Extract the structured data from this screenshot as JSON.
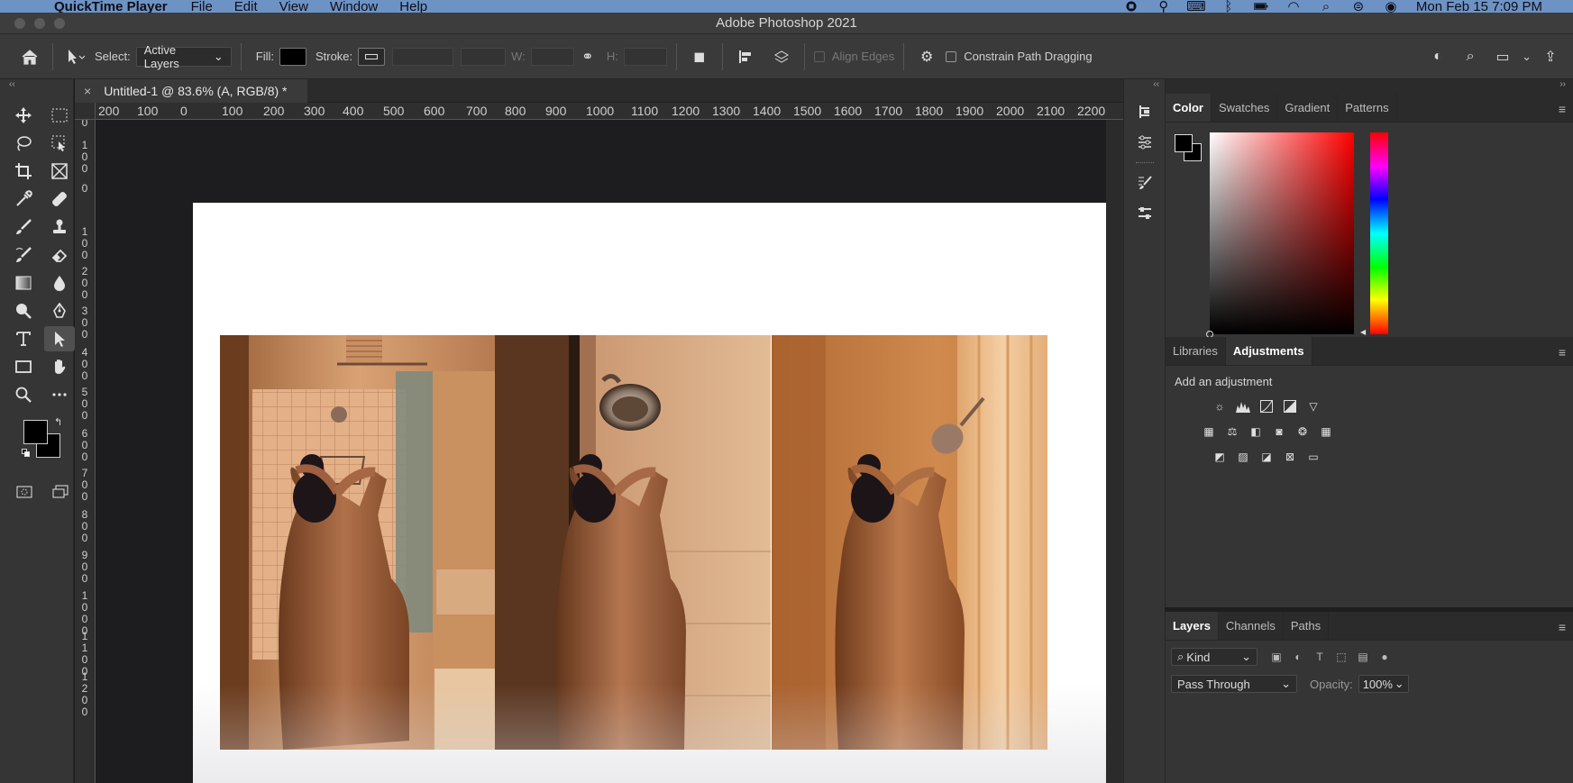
{
  "menubar": {
    "app": "QuickTime Player",
    "items": [
      "File",
      "Edit",
      "View",
      "Window",
      "Help"
    ],
    "clock": "Mon Feb 15  7:09 PM",
    "status_icons": [
      "record-icon",
      "accessibility-icon",
      "keyboard-icon",
      "bluetooth-icon",
      "battery-icon",
      "wifi-icon",
      "spotlight-icon",
      "control-center-icon",
      "siri-icon"
    ]
  },
  "window": {
    "title": "Adobe Photoshop 2021"
  },
  "options": {
    "select_label": "Select:",
    "select_value": "Active Layers",
    "fill_label": "Fill:",
    "stroke_label": "Stroke:",
    "w_label": "W:",
    "h_label": "H:",
    "align_edges": "Align Edges",
    "constrain": "Constrain Path Dragging",
    "fill_color": "#000000"
  },
  "document": {
    "tab": "Untitled-1 @ 83.6% (A, RGB/8) *",
    "close": "×"
  },
  "ruler": {
    "h_ticks": [
      "200",
      "100",
      "0",
      "100",
      "200",
      "300",
      "400",
      "500",
      "600",
      "700",
      "800",
      "900",
      "1000",
      "1100",
      "1200",
      "1300",
      "1400",
      "1500",
      "1600",
      "1700",
      "1800",
      "1900",
      "2000",
      "2100",
      "2200"
    ],
    "v_ticks": [
      "0",
      "100",
      "0",
      "100",
      "200",
      "300",
      "400",
      "500",
      "600",
      "700",
      "800",
      "900",
      "1000",
      "1100",
      "1200"
    ]
  },
  "colors": {
    "foreground": "#000000",
    "background": "#000000",
    "canvas": "#ffffff",
    "artboard_bg": "#1d1d1f"
  },
  "panels": {
    "color_tabs": [
      "Color",
      "Swatches",
      "Gradient",
      "Patterns"
    ],
    "adj_tabs": [
      "Libraries",
      "Adjustments"
    ],
    "adj_title": "Add an adjustment",
    "layer_tabs": [
      "Layers",
      "Channels",
      "Paths"
    ],
    "kind": "Kind",
    "blend_mode": "Pass Through",
    "opacity_label": "Opacity:",
    "opacity_value": "100%"
  }
}
